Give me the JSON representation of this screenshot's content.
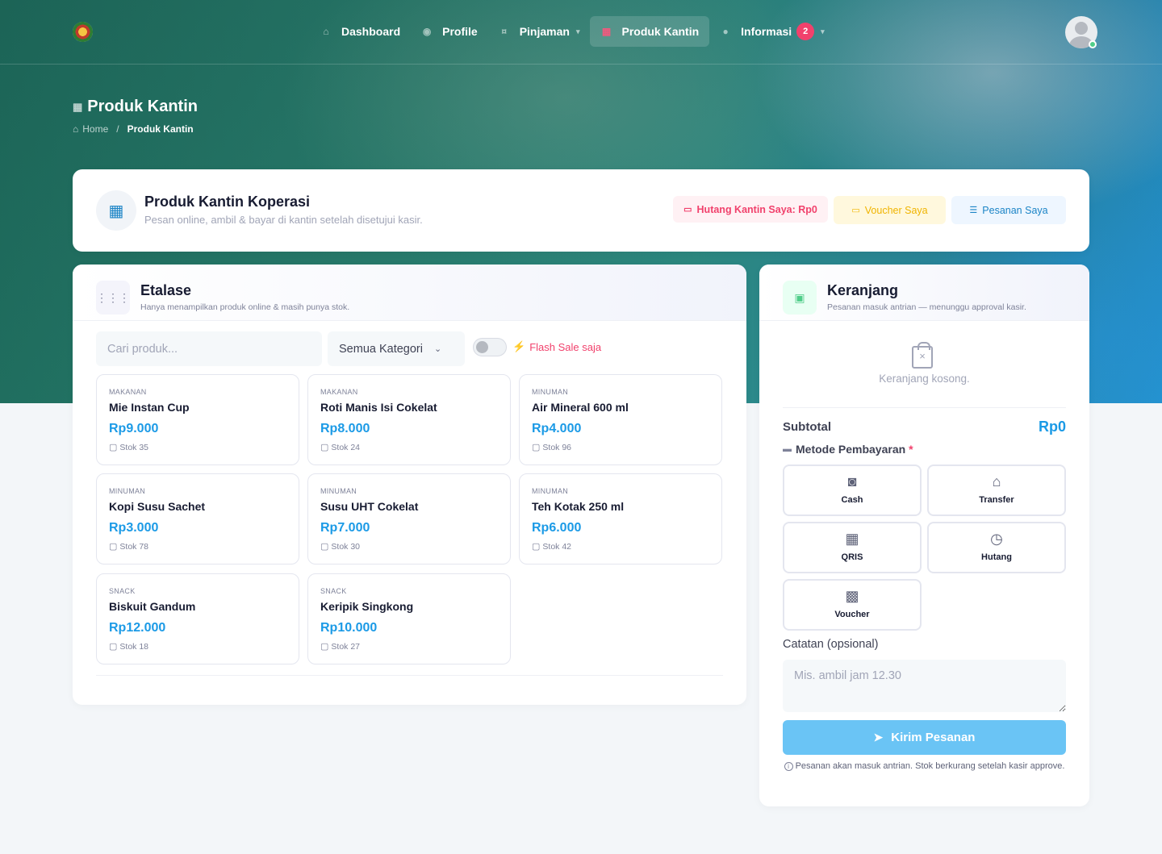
{
  "nav": {
    "items": [
      {
        "label": "Dashboard",
        "icon": "home-icon"
      },
      {
        "label": "Profile",
        "icon": "user-icon"
      },
      {
        "label": "Pinjaman",
        "icon": "money-icon"
      },
      {
        "label": "Produk Kantin",
        "icon": "store-icon"
      },
      {
        "label": "Informasi",
        "icon": "info-icon"
      }
    ],
    "info_badge": "2"
  },
  "page": {
    "title": "Produk Kantin",
    "breadcrumb_home": "Home",
    "breadcrumb_sep": "/",
    "breadcrumb_current": "Produk Kantin"
  },
  "header_card": {
    "title": "Produk Kantin Koperasi",
    "subtitle": "Pesan online, ambil & bayar di kantin setelah disetujui kasir.",
    "debt_label": "Hutang Kantin Saya: Rp0",
    "voucher_label": "Voucher Saya",
    "orders_label": "Pesanan Saya"
  },
  "etalase": {
    "title": "Etalase",
    "subtitle": "Hanya menampilkan produk online & masih punya stok.",
    "search_placeholder": "Cari produk...",
    "category_selected": "Semua Kategori",
    "flash_label": "Flash Sale saja",
    "flash_enabled": false,
    "products": [
      {
        "category": "MAKANAN",
        "name": "Mie Instan Cup",
        "price": "Rp9.000",
        "stock": "Stok 35"
      },
      {
        "category": "MAKANAN",
        "name": "Roti Manis Isi Cokelat",
        "price": "Rp8.000",
        "stock": "Stok 24"
      },
      {
        "category": "MINUMAN",
        "name": "Air Mineral 600 ml",
        "price": "Rp4.000",
        "stock": "Stok 96"
      },
      {
        "category": "MINUMAN",
        "name": "Kopi Susu Sachet",
        "price": "Rp3.000",
        "stock": "Stok 78"
      },
      {
        "category": "MINUMAN",
        "name": "Susu UHT Cokelat",
        "price": "Rp7.000",
        "stock": "Stok 30"
      },
      {
        "category": "MINUMAN",
        "name": "Teh Kotak 250 ml",
        "price": "Rp6.000",
        "stock": "Stok 42"
      },
      {
        "category": "SNACK",
        "name": "Biskuit Gandum",
        "price": "Rp12.000",
        "stock": "Stok 18"
      },
      {
        "category": "SNACK",
        "name": "Keripik Singkong",
        "price": "Rp10.000",
        "stock": "Stok 27"
      }
    ]
  },
  "cart": {
    "title": "Keranjang",
    "subtitle": "Pesanan masuk antrian — menunggu approval kasir.",
    "empty_text": "Keranjang kosong.",
    "subtotal_label": "Subtotal",
    "subtotal_value": "Rp0",
    "payment_label": "Metode Pembayaran",
    "required_mark": "*",
    "payment_options": [
      {
        "label": "Cash",
        "icon": "cash-icon"
      },
      {
        "label": "Transfer",
        "icon": "bank-icon"
      },
      {
        "label": "QRIS",
        "icon": "qr-icon"
      },
      {
        "label": "Hutang",
        "icon": "clock-icon"
      },
      {
        "label": "Voucher",
        "icon": "ticket-icon"
      }
    ],
    "notes_label": "Catatan (opsional)",
    "notes_placeholder": "Mis. ambil jam 12.30",
    "submit_label": "Kirim Pesanan",
    "footnote": "Pesanan akan masuk antrian. Stok berkurang setelah kasir approve."
  },
  "colors": {
    "accent": "#1b9ae6",
    "danger": "#f1416c",
    "warning": "#f0b400",
    "success": "#50cd89"
  }
}
